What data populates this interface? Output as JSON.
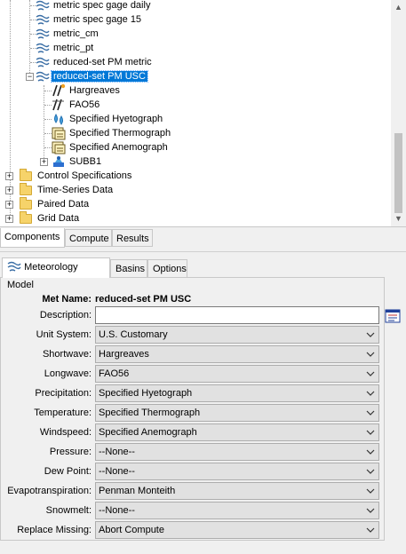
{
  "tree": {
    "items": [
      {
        "label": "metric spec gage daily",
        "icon": "met-model-icon"
      },
      {
        "label": "metric spec gage 15",
        "icon": "met-model-icon"
      },
      {
        "label": "metric_cm",
        "icon": "met-model-icon"
      },
      {
        "label": "metric_pt",
        "icon": "met-model-icon"
      },
      {
        "label": "reduced-set PM metric",
        "icon": "met-model-icon"
      },
      {
        "label": "reduced-set PM USC",
        "icon": "met-model-icon",
        "selected": true
      },
      {
        "label": "Hargreaves",
        "icon": "shortwave-icon"
      },
      {
        "label": "FAO56",
        "icon": "longwave-icon"
      },
      {
        "label": "Specified Hyetograph",
        "icon": "precip-icon"
      },
      {
        "label": "Specified Thermograph",
        "icon": "gage-icon"
      },
      {
        "label": "Specified Anemograph",
        "icon": "gage-icon"
      },
      {
        "label": "SUBB1",
        "icon": "subbasin-icon"
      },
      {
        "label": "Control Specifications",
        "icon": "folder-icon"
      },
      {
        "label": "Time-Series Data",
        "icon": "folder-icon"
      },
      {
        "label": "Paired Data",
        "icon": "folder-icon"
      },
      {
        "label": "Grid Data",
        "icon": "folder-icon"
      }
    ],
    "tabs": [
      "Components",
      "Compute",
      "Results"
    ],
    "active_tab": "Components"
  },
  "props": {
    "tabs": [
      "Meteorology Model",
      "Basins",
      "Options"
    ],
    "active_tab": "Meteorology Model",
    "met_name_label": "Met Name:",
    "met_name_value": "reduced-set PM USC",
    "description_label": "Description:",
    "description_value": "",
    "fields": [
      {
        "label": "Unit System:",
        "value": "U.S. Customary"
      },
      {
        "label": "Shortwave:",
        "value": "Hargreaves"
      },
      {
        "label": "Longwave:",
        "value": "FAO56"
      },
      {
        "label": "Precipitation:",
        "value": "Specified Hyetograph"
      },
      {
        "label": "Temperature:",
        "value": "Specified Thermograph"
      },
      {
        "label": "Windspeed:",
        "value": "Specified Anemograph"
      },
      {
        "label": "Pressure:",
        "value": "--None--"
      },
      {
        "label": "Dew Point:",
        "value": "--None--"
      },
      {
        "label": "Evapotranspiration:",
        "value": "Penman Monteith"
      },
      {
        "label": "Snowmelt:",
        "value": "--None--"
      },
      {
        "label": "Replace Missing:",
        "value": "Abort Compute"
      }
    ]
  }
}
